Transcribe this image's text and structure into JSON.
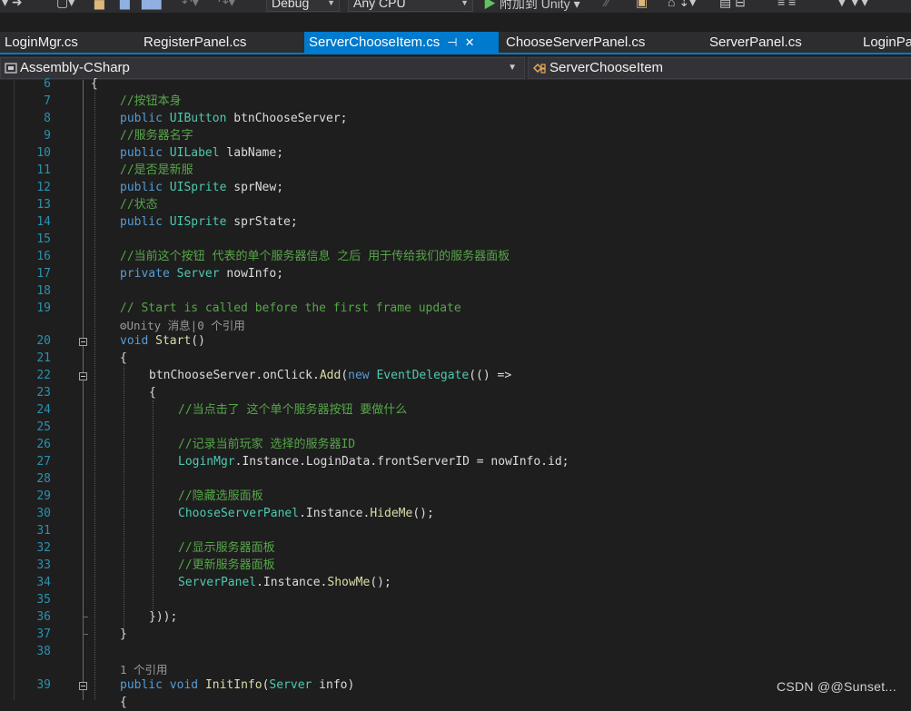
{
  "toolbar": {
    "config": "Debug",
    "platform": "Any CPU",
    "attach_label": "附加到 Unity"
  },
  "tabs": [
    {
      "label": "LoginMgr.cs",
      "active": false
    },
    {
      "label": "RegisterPanel.cs",
      "active": false
    },
    {
      "label": "ServerChooseItem.cs",
      "active": true
    },
    {
      "label": "ChooseServerPanel.cs",
      "active": false
    },
    {
      "label": "ServerPanel.cs",
      "active": false
    },
    {
      "label": "LoginPa",
      "active": false
    }
  ],
  "nav": {
    "project": "Assembly-CSharp",
    "class": "ServerChooseItem"
  },
  "lens": {
    "start_refs": "Unity 消息|0 个引用",
    "initinfo_refs": "1 个引用"
  },
  "lines": {
    "l6": "6",
    "l7": "7",
    "l8": "8",
    "l9": "9",
    "l10": "10",
    "l11": "11",
    "l12": "12",
    "l13": "13",
    "l14": "14",
    "l15": "15",
    "l16": "16",
    "l17": "17",
    "l18": "18",
    "l19": "19",
    "l20": "20",
    "l21": "21",
    "l22": "22",
    "l23": "23",
    "l24": "24",
    "l25": "25",
    "l26": "26",
    "l27": "27",
    "l28": "28",
    "l29": "29",
    "l30": "30",
    "l31": "31",
    "l32": "32",
    "l33": "33",
    "l34": "34",
    "l35": "35",
    "l36": "36",
    "l37": "37",
    "l38": "38",
    "l39": "39"
  },
  "code": {
    "l6": "{",
    "l7": "//按钮本身",
    "l8_kw": "public",
    "l8_type": "UIButton",
    "l8_rest": " btnChooseServer;",
    "l9": "//服务器名字",
    "l10_kw": "public",
    "l10_type": "UILabel",
    "l10_rest": " labName;",
    "l11": "//是否是新服",
    "l12_kw": "public",
    "l12_type": "UISprite",
    "l12_rest": " sprNew;",
    "l13": "//状态",
    "l14_kw": "public",
    "l14_type": "UISprite",
    "l14_rest": " sprState;",
    "l16": "//当前这个按钮 代表的单个服务器信息 之后 用于传给我们的服务器面板",
    "l17_kw": "private",
    "l17_type": "Server",
    "l17_rest": " nowInfo;",
    "l19": "// Start is called before the first frame update",
    "l20_kw": "void",
    "l20_fn": "Start",
    "l20_rest": "()",
    "l21": "{",
    "l22_a": "btnChooseServer.onClick.",
    "l22_fn": "Add",
    "l22_b": "(",
    "l22_kw": "new",
    "l22_type": "EventDelegate",
    "l22_c": "(() =>",
    "l23": "{",
    "l24": "//当点击了 这个单个服务器按钮 要做什么",
    "l26": "//记录当前玩家 选择的服务器ID",
    "l27_type": "LoginMgr",
    "l27_rest": ".Instance.LoginData.frontServerID = nowInfo.id;",
    "l29": "//隐藏选服面板",
    "l30_type": "ChooseServerPanel",
    "l30_a": ".Instance.",
    "l30_fn": "HideMe",
    "l30_b": "();",
    "l32": "//显示服务器面板",
    "l33": "//更新服务器面板",
    "l34_type": "ServerPanel",
    "l34_a": ".Instance.",
    "l34_fn": "ShowMe",
    "l34_b": "();",
    "l36": "}));",
    "l37": "}",
    "l39_kw1": "public",
    "l39_kw2": "void",
    "l39_fn": "InitInfo",
    "l39_a": "(",
    "l39_type": "Server",
    "l39_b": " info)"
  },
  "watermark": "CSDN @@Sunset..."
}
